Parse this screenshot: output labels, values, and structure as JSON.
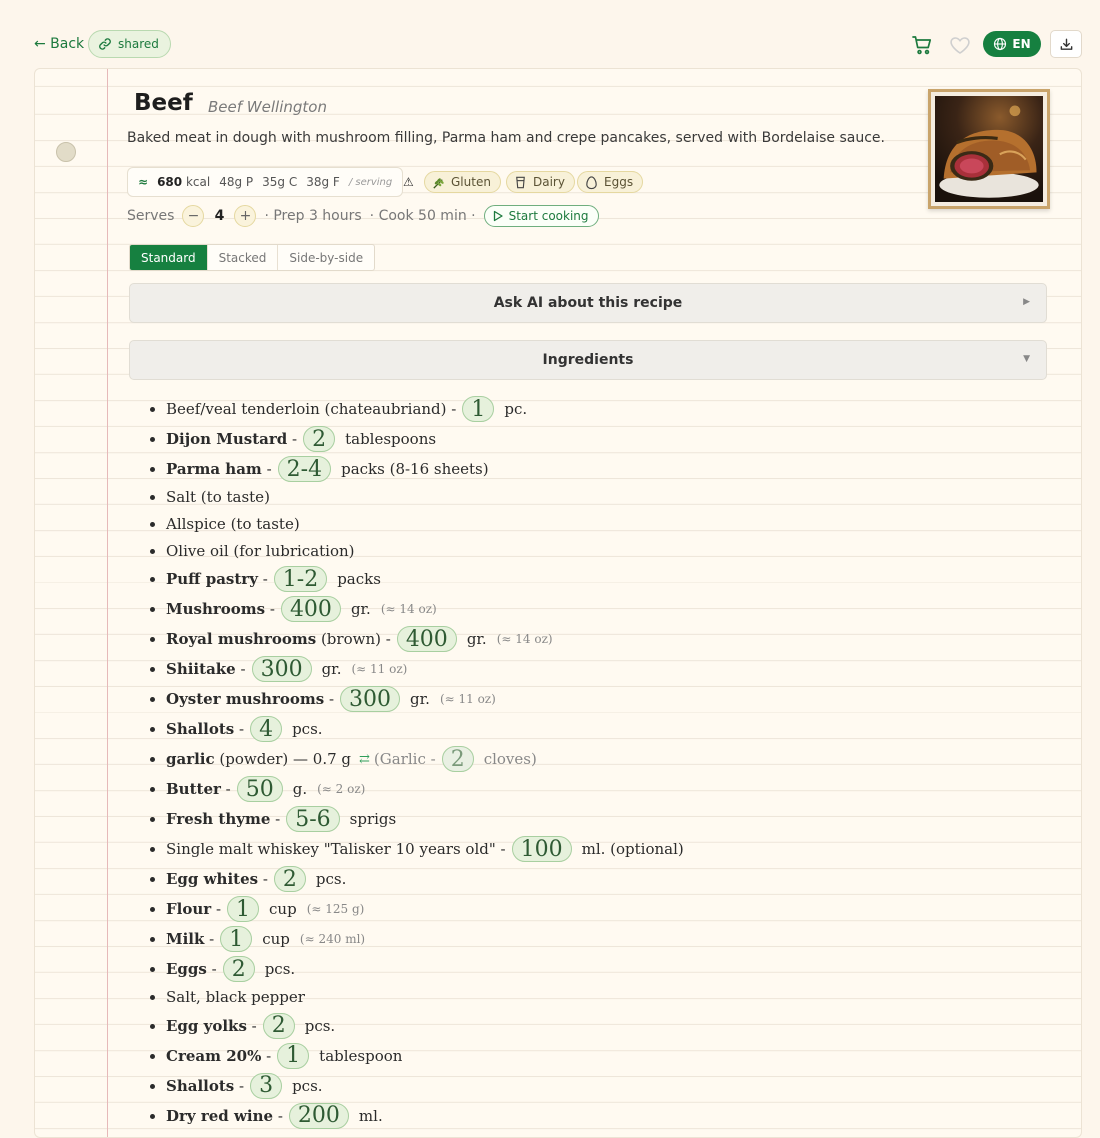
{
  "topbar": {
    "back_label": "← Back",
    "shared_label": "shared",
    "lang_label": "EN"
  },
  "recipe": {
    "title": "Beef",
    "subtitle": "Beef Wellington",
    "description": "Baked meat in dough with mushroom filling, Parma ham and crepe pancakes, served with Bordelaise sauce.",
    "nutrition": {
      "kcal_icon": "≈",
      "kcal_value": "680",
      "kcal_unit": "kcal",
      "protein": "48g P",
      "carbs": "35g C",
      "fat": "38g F",
      "per": "/ serving"
    },
    "warning_icon": "⚠",
    "allergens": [
      "Gluten",
      "Dairy",
      "Eggs"
    ],
    "serves_label": "Serves",
    "serves_minus": "−",
    "serves_count": "4",
    "serves_plus": "+",
    "prep": "· Prep 3 hours",
    "cook": "· Cook 50 min ·",
    "start_label": "Start cooking"
  },
  "view_tabs": [
    "Standard",
    "Stacked",
    "Side-by-side"
  ],
  "ask_ai_label": "Ask AI about this recipe",
  "ask_ai_chevron": "▶",
  "ingredients_label": "Ingredients",
  "ingredients_chevron": "▼",
  "ingredients": [
    {
      "bold": "",
      "plain": "Beef/veal tenderloin (chateaubriand)",
      "sep": " -",
      "qty": "1",
      "unit": "pc.",
      "conv": ""
    },
    {
      "bold": "Dijon Mustard",
      "plain": "",
      "sep": " -",
      "qty": "2",
      "unit": "tablespoons",
      "conv": ""
    },
    {
      "bold": "Parma ham",
      "plain": "",
      "sep": " -",
      "qty": "2-4",
      "unit": "packs (8-16 sheets)",
      "conv": ""
    },
    {
      "bold": "",
      "plain": "Salt (to taste)",
      "sep": "",
      "qty": "",
      "unit": "",
      "conv": ""
    },
    {
      "bold": "",
      "plain": "Allspice (to taste)",
      "sep": "",
      "qty": "",
      "unit": "",
      "conv": ""
    },
    {
      "bold": "",
      "plain": "Olive oil (for lubrication)",
      "sep": "",
      "qty": "",
      "unit": "",
      "conv": ""
    },
    {
      "bold": "Puff pastry",
      "plain": "",
      "sep": " -",
      "qty": "1-2",
      "unit": "packs",
      "conv": ""
    },
    {
      "bold": "Mushrooms",
      "plain": "",
      "sep": " -",
      "qty": "400",
      "unit": "gr.",
      "conv": "(≈ 14 oz)"
    },
    {
      "bold": "Royal mushrooms",
      "plain": " (brown)",
      "sep": " -",
      "qty": "400",
      "unit": "gr.",
      "conv": "(≈ 14 oz)"
    },
    {
      "bold": "Shiitake",
      "plain": "",
      "sep": " -",
      "qty": "300",
      "unit": "gr.",
      "conv": "(≈ 11 oz)"
    },
    {
      "bold": "Oyster mushrooms",
      "plain": "",
      "sep": " -",
      "qty": "300",
      "unit": "gr.",
      "conv": "(≈ 11 oz)"
    },
    {
      "bold": "Shallots",
      "plain": "",
      "sep": " -",
      "qty": "4",
      "unit": "pcs.",
      "conv": ""
    },
    {
      "bold": "garlic",
      "plain": " (powder) — 0.7 g",
      "sep": "",
      "qty": "2",
      "unit": "cloves)",
      "conv": "",
      "swap": "⇄",
      "alt": "(Garlic -"
    },
    {
      "bold": "Butter",
      "plain": "",
      "sep": " -",
      "qty": "50",
      "unit": "g.",
      "conv": "(≈ 2 oz)"
    },
    {
      "bold": "Fresh thyme",
      "plain": "",
      "sep": " -",
      "qty": "5-6",
      "unit": "sprigs",
      "conv": ""
    },
    {
      "bold": "",
      "plain": "Single malt whiskey \"Talisker 10 years old\"",
      "sep": " -",
      "qty": "100",
      "unit": "ml. (optional)",
      "conv": ""
    },
    {
      "bold": "Egg whites",
      "plain": "",
      "sep": " -",
      "qty": "2",
      "unit": "pcs.",
      "conv": ""
    },
    {
      "bold": "Flour",
      "plain": "",
      "sep": " -",
      "qty": "1",
      "unit": "cup",
      "conv": "(≈ 125 g)"
    },
    {
      "bold": "Milk",
      "plain": "",
      "sep": " -",
      "qty": "1",
      "unit": "cup",
      "conv": "(≈ 240 ml)"
    },
    {
      "bold": "Eggs",
      "plain": "",
      "sep": " -",
      "qty": "2",
      "unit": "pcs.",
      "conv": ""
    },
    {
      "bold": "",
      "plain": "Salt, black pepper",
      "sep": "",
      "qty": "",
      "unit": "",
      "conv": ""
    },
    {
      "bold": "Egg yolks",
      "plain": "",
      "sep": " -",
      "qty": "2",
      "unit": "pcs.",
      "conv": ""
    },
    {
      "bold": "Cream 20%",
      "plain": "",
      "sep": " -",
      "qty": "1",
      "unit": "tablespoon",
      "conv": ""
    },
    {
      "bold": "Shallots",
      "plain": "",
      "sep": " -",
      "qty": "3",
      "unit": "pcs.",
      "conv": ""
    },
    {
      "bold": "Dry red wine",
      "plain": "",
      "sep": " -",
      "qty": "200",
      "unit": "ml.",
      "conv": ""
    }
  ],
  "colors": {
    "accent": "#168040",
    "paper": "#fffaf1",
    "margin_line": "#e6b9b9",
    "qty_pill": "#e6f1dc"
  }
}
